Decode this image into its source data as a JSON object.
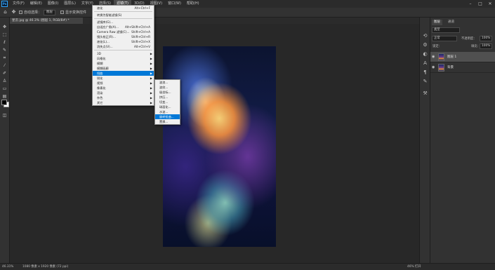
{
  "menubar": {
    "logo": "Ps",
    "items": [
      "文件(F)",
      "编辑(E)",
      "图像(I)",
      "图层(L)",
      "文字(Y)",
      "选择(S)",
      "滤镜(T)",
      "3D(D)",
      "视图(V)",
      "窗口(W)",
      "帮助(H)"
    ],
    "active_index": 6
  },
  "optbar": {
    "auto_select_label": "自动选择：",
    "auto_select_value": "图层",
    "show_transform_label": "显示变换控件"
  },
  "document": {
    "tab_title": "星云.jpg @ 46.3% (图层 1, RGB/8#) *"
  },
  "filter_menu": {
    "items": [
      {
        "label": "液化",
        "shortcut": "Alt+Ctrl+F"
      },
      {
        "sep": true
      },
      {
        "label": "转换为智能滤镜(S)"
      },
      {
        "sep": true
      },
      {
        "label": "滤镜库(G)..."
      },
      {
        "label": "自适应广角(A)...",
        "shortcut": "Alt+Shift+Ctrl+A"
      },
      {
        "label": "Camera Raw 滤镜(C)...",
        "shortcut": "Shift+Ctrl+A"
      },
      {
        "label": "镜头校正(R)...",
        "shortcut": "Shift+Ctrl+R"
      },
      {
        "label": "液化(L)...",
        "shortcut": "Shift+Ctrl+X"
      },
      {
        "label": "消失点(V)...",
        "shortcut": "Alt+Ctrl+V"
      },
      {
        "sep": true
      },
      {
        "label": "3D",
        "submenu": true
      },
      {
        "label": "风格化",
        "submenu": true
      },
      {
        "label": "模糊",
        "submenu": true
      },
      {
        "label": "模糊画廊",
        "submenu": true
      },
      {
        "label": "扭曲",
        "submenu": true,
        "highlighted": true
      },
      {
        "label": "锐化",
        "submenu": true
      },
      {
        "label": "视频",
        "submenu": true
      },
      {
        "label": "像素化",
        "submenu": true
      },
      {
        "label": "渲染",
        "submenu": true
      },
      {
        "label": "杂色",
        "submenu": true
      },
      {
        "label": "其它",
        "submenu": true
      }
    ]
  },
  "distort_submenu": {
    "items": [
      {
        "label": "波浪..."
      },
      {
        "label": "波纹..."
      },
      {
        "label": "极坐标..."
      },
      {
        "label": "挤压..."
      },
      {
        "label": "切变..."
      },
      {
        "label": "球面化..."
      },
      {
        "label": "水波..."
      },
      {
        "label": "旋转扭曲...",
        "highlighted": true
      },
      {
        "label": "置换..."
      }
    ]
  },
  "layers_panel": {
    "tabs": [
      "图层",
      "通道"
    ],
    "kind_label": "类型",
    "blend_mode": "正常",
    "opacity_label": "不透明度：",
    "opacity_value": "100%",
    "lock_label": "锁定：",
    "fill_label": "填充：",
    "fill_value": "100%",
    "layers": [
      {
        "name": "图层 1",
        "selected": true
      },
      {
        "name": "背景",
        "selected": false
      }
    ]
  },
  "statusbar": {
    "zoom": "46.31%",
    "doc_info": "1080 像素 x 1920 像素 (72 ppi)",
    "right": "46% 打开"
  },
  "colors": {
    "accent": "#0078d7",
    "menubar": "#2b2b2b",
    "panel": "#323232",
    "canvas": "#282828"
  }
}
